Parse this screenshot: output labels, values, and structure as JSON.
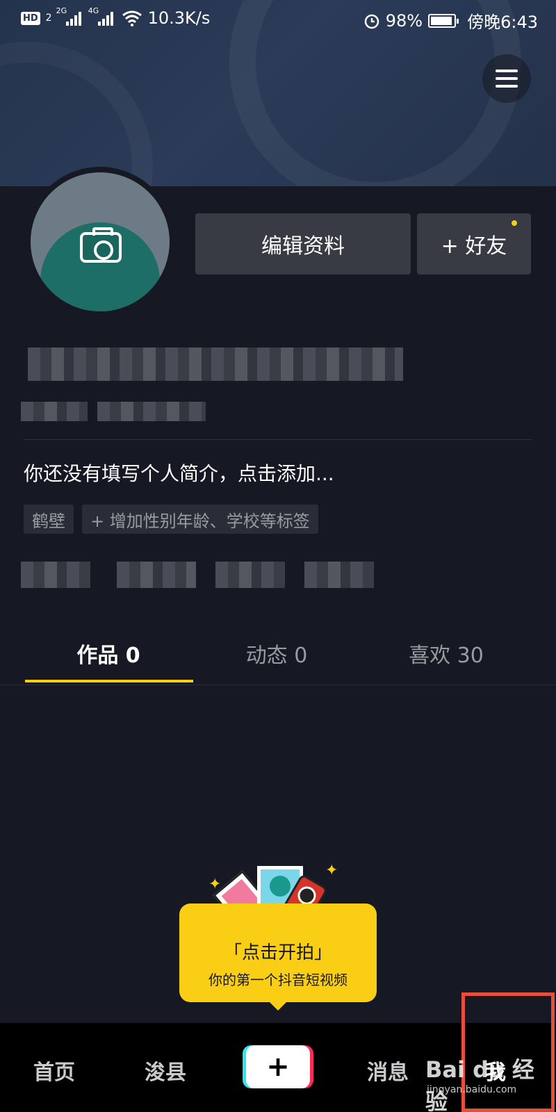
{
  "status_bar": {
    "hd_badge": "HD",
    "sim_slot": "2",
    "net1": "2G",
    "net2": "4G",
    "speed": "10.3K/s",
    "battery": "98%",
    "time": "傍晚6:43"
  },
  "profile": {
    "edit_button": "编辑资料",
    "add_friend_button": "+ 好友",
    "bio_placeholder": "你还没有填写个人简介，点击添加...",
    "tags": [
      "鹤壁",
      "+ 增加性别年龄、学校等标签"
    ]
  },
  "tabs": [
    {
      "label": "作品 0",
      "active": true
    },
    {
      "label": "动态 0",
      "active": false
    },
    {
      "label": "喜欢 30",
      "active": false
    }
  ],
  "promo": {
    "title": "「点击开拍」",
    "subtitle": "你的第一个抖音短视频"
  },
  "bottom_nav": {
    "home": "首页",
    "city": "浚县",
    "messages": "消息",
    "me": "我"
  },
  "watermark": {
    "brand": "Bai du 经验",
    "url": "jingyan.baidu.com"
  },
  "colors": {
    "background": "#161823",
    "accent_yellow": "#face15",
    "highlight_box": "#e84e3c"
  }
}
